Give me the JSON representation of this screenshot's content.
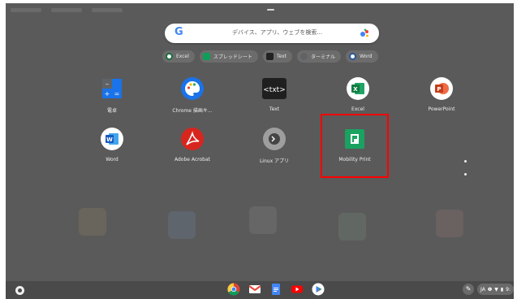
{
  "search": {
    "logo": "G",
    "placeholder": "デバイス、アプリ、ウェブを検索..."
  },
  "suggestions": [
    {
      "label": "Excel",
      "icon": "excel-icon",
      "color": "#1d6f42"
    },
    {
      "label": "スプレッドシート",
      "icon": "sheets-icon",
      "color": "#0f9d58"
    },
    {
      "label": "Text",
      "icon": "text-icon",
      "color": "#333333"
    },
    {
      "label": "ターミナル",
      "icon": "terminal-icon",
      "color": "#5f6368"
    },
    {
      "label": "Word",
      "icon": "word-icon",
      "color": "#2b579a"
    }
  ],
  "apps": [
    {
      "label": "電卓",
      "icon": "calculator-icon"
    },
    {
      "label": "Chrome 描画キ...",
      "icon": "chrome-canvas-icon"
    },
    {
      "label": "Text",
      "icon": "text-icon"
    },
    {
      "label": "Excel",
      "icon": "excel-icon"
    },
    {
      "label": "PowerPoint",
      "icon": "powerpoint-icon"
    },
    {
      "label": "Word",
      "icon": "word-icon"
    },
    {
      "label": "Adobe Acrobat",
      "icon": "acrobat-icon"
    },
    {
      "label": "Linux アプリ",
      "icon": "linux-apps-icon"
    },
    {
      "label": "Mobility Print",
      "icon": "mobility-print-icon"
    }
  ],
  "shelf": {
    "pinned": [
      "chrome-icon",
      "gmail-icon",
      "docs-icon",
      "youtube-icon",
      "play-store-icon"
    ],
    "status_text": "JA",
    "status_tail": "9:"
  },
  "colors": {
    "highlight": "#ff0000",
    "background": "#5a5a5a"
  }
}
